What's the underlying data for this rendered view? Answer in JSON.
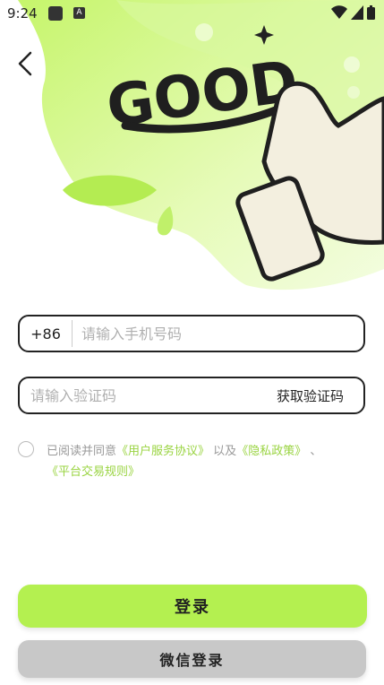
{
  "status_bar": {
    "time": "9:24",
    "badge": "A"
  },
  "hero": {
    "logo_text": "GOOD"
  },
  "phone": {
    "country_code": "+86",
    "placeholder": "请输入手机号码"
  },
  "verify": {
    "placeholder": "请输入验证码",
    "get_code_label": "获取验证码"
  },
  "agreement": {
    "prefix": "已阅读并同意",
    "link1": "《用户服务协议》",
    "mid": "以及",
    "link2": "《隐私政策》",
    "sep": "、",
    "link3": "《平台交易规则》"
  },
  "buttons": {
    "login": "登录",
    "wechat_login": "微信登录"
  },
  "colors": {
    "accent": "#b4f050",
    "link": "#9ad442",
    "secondary_button": "#c8c8c8"
  }
}
